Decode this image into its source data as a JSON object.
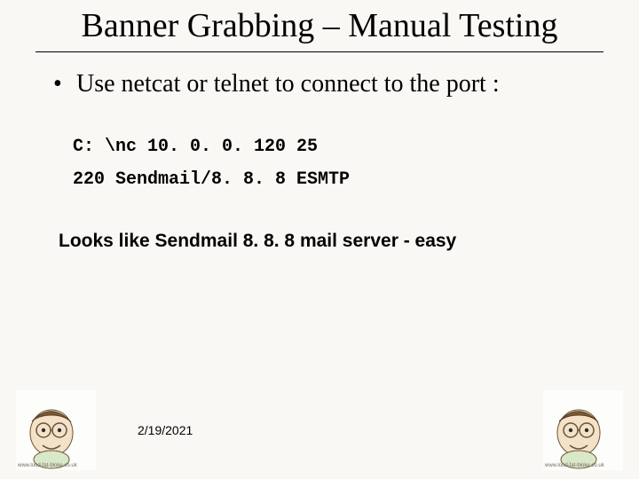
{
  "title": "Banner Grabbing – Manual Testing",
  "bullet1": "Use netcat or telnet to connect to the port :",
  "code": {
    "line1": "C: \\nc 10. 0. 0. 120 25",
    "line2": "220 Sendmail/8. 8. 8 ESMTP"
  },
  "conclusion": "Looks like Sendmail 8. 8. 8 mail server - easy",
  "date": "2/19/2021",
  "cartoon_credit": "www.loud-fat-bloke.co.uk"
}
